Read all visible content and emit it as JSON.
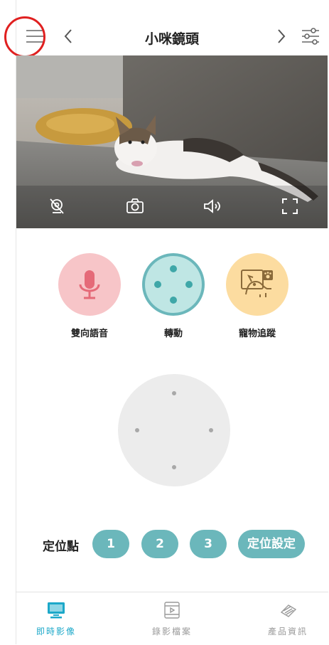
{
  "header": {
    "title": "小咪鏡頭"
  },
  "features": [
    {
      "label": "雙向語音",
      "icon": "microphone-icon",
      "color": "#f7c5c8"
    },
    {
      "label": "轉動",
      "icon": "dpad-icon",
      "color": "#bfe6e4"
    },
    {
      "label": "寵物追蹤",
      "icon": "pet-tracking-icon",
      "color": "#fcdca0"
    }
  ],
  "presets": {
    "label": "定位點",
    "buttons": [
      "1",
      "2",
      "3"
    ],
    "settings_label": "定位設定"
  },
  "nav": [
    {
      "label": "即時影像",
      "active": true
    },
    {
      "label": "錄影檔案",
      "active": false
    },
    {
      "label": "產品資訊",
      "active": false
    }
  ],
  "colors": {
    "accent": "#6bb7bb",
    "active_nav": "#1ca8c9",
    "inactive_nav": "#9a9a9a",
    "highlight_circle": "#e02020"
  }
}
